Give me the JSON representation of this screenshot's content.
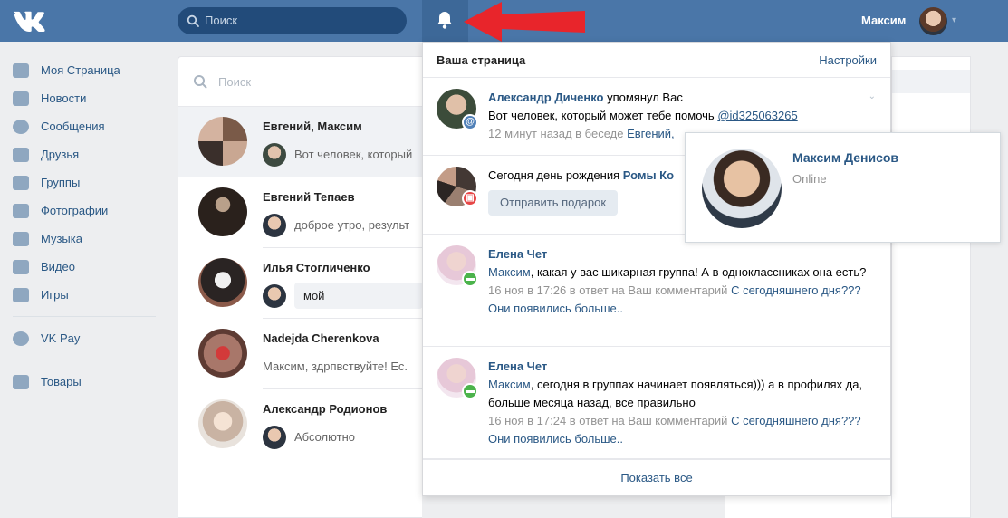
{
  "colors": {
    "header": "#4a76a8",
    "link": "#2a5885",
    "bg": "#edeef0"
  },
  "header": {
    "logo": "VK",
    "search_placeholder": "Поиск",
    "bell_icon": "bell-icon",
    "user_name": "Максим"
  },
  "nav": {
    "items": [
      {
        "label": "Моя Страница",
        "icon": "home-icon"
      },
      {
        "label": "Новости",
        "icon": "news-icon"
      },
      {
        "label": "Сообщения",
        "icon": "message-icon"
      },
      {
        "label": "Друзья",
        "icon": "friends-icon"
      },
      {
        "label": "Группы",
        "icon": "groups-icon"
      },
      {
        "label": "Фотографии",
        "icon": "camera-icon"
      },
      {
        "label": "Музыка",
        "icon": "music-icon"
      },
      {
        "label": "Видео",
        "icon": "video-icon"
      },
      {
        "label": "Игры",
        "icon": "games-icon"
      }
    ],
    "pay": "VK Pay",
    "goods": "Товары"
  },
  "messages": {
    "search_placeholder": "Поиск",
    "dialogs": [
      {
        "name": "Евгений, Максим",
        "preview": "Вот человек, который"
      },
      {
        "name": "Евгений Тепаев",
        "preview": "доброе утро, результ"
      },
      {
        "name": "Илья Стогличенко",
        "preview": "мой"
      },
      {
        "name": "Nadejda Cherenkova",
        "preview": "Максим, здрпвствуйте! Ес."
      },
      {
        "name": "Александр Родионов",
        "preview": "Абсолютно"
      }
    ]
  },
  "notifications": {
    "title": "Ваша страница",
    "settings": "Настройки",
    "show_all": "Показать все",
    "n1": {
      "author": "Александр Диченко",
      "action": " упомянул Вас",
      "text": "Вот человек, который может тебе помочь ",
      "mention": "@id325063265",
      "meta": "12 минут назад в беседе ",
      "meta_link": "Евгений,"
    },
    "n2": {
      "text": "Сегодня день рождения ",
      "name": "Ромы Ко",
      "button": "Отправить подарок"
    },
    "n3": {
      "author": "Елена Чет",
      "reply_to": "Максим",
      "text": ", какая у вас шикарная группа! А в одноклассниках она есть?",
      "meta": "16 ноя в 17:26 в ответ на Ваш комментарий ",
      "meta_link": "С сегодняшнего дня??? Они появились больше.."
    },
    "n4": {
      "author": "Елена Чет",
      "reply_to": "Максим",
      "text": ", сегодня в группах начинает появляться))) а в профилях да, больше месяца назад, все правильно",
      "meta": "16 ноя в 17:24 в ответ на Ваш комментарий ",
      "meta_link": "С сегодняшнего дня??? Они появились больше.."
    }
  },
  "popup": {
    "name": "Максим Денисов",
    "status": "Online"
  }
}
